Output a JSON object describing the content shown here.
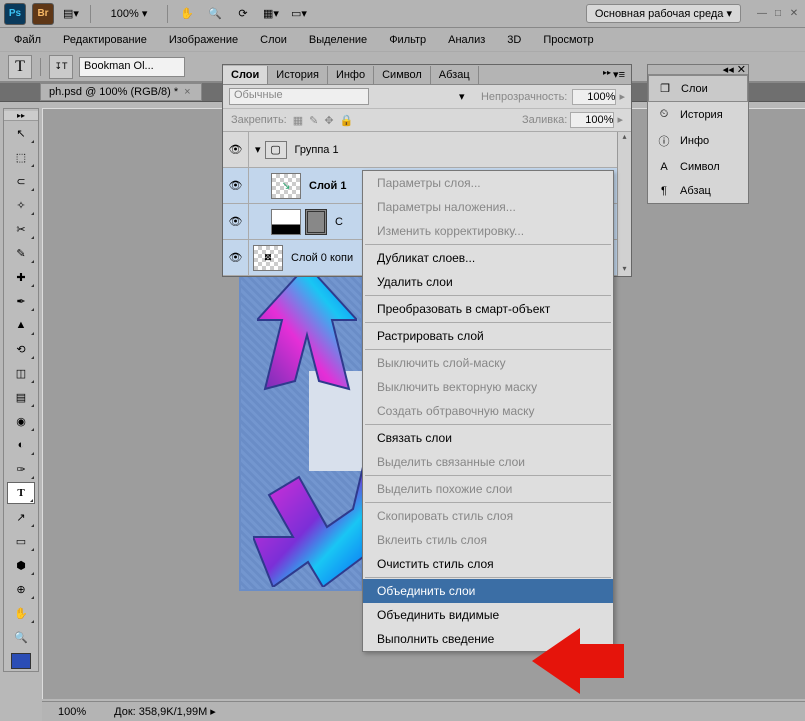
{
  "top": {
    "ps": "Ps",
    "br": "Br",
    "zoom": "100% ▾",
    "workspace": "Основная рабочая среда ▾"
  },
  "menu": [
    "Файл",
    "Редактирование",
    "Изображение",
    "Слои",
    "Выделение",
    "Фильтр",
    "Анализ",
    "3D",
    "Просмотр"
  ],
  "options": {
    "font": "Bookman Ol..."
  },
  "doc_tab": "ph.psd @ 100% (RGB/8) *",
  "layers_panel": {
    "tabs": [
      "Слои",
      "История",
      "Инфо",
      "Символ",
      "Абзац"
    ],
    "mode": "Обычные",
    "opacity_label": "Непрозрачность:",
    "opacity_val": "100%",
    "lock_label": "Закрепить:",
    "fill_label": "Заливка:",
    "fill_val": "100%",
    "rows": [
      {
        "name": "Группа 1"
      },
      {
        "name": "Слой 1"
      },
      {
        "name": "С"
      },
      {
        "name": "Слой 0 копи"
      }
    ]
  },
  "ctx": [
    {
      "t": "Параметры слоя...",
      "d": true
    },
    {
      "t": "Параметры наложения...",
      "d": true
    },
    {
      "t": "Изменить корректировку...",
      "d": true
    },
    {
      "sep": true
    },
    {
      "t": "Дубликат слоев..."
    },
    {
      "t": "Удалить слои"
    },
    {
      "sep": true
    },
    {
      "t": "Преобразовать в смарт-объект"
    },
    {
      "sep": true
    },
    {
      "t": "Растрировать слой"
    },
    {
      "sep": true
    },
    {
      "t": "Выключить слой-маску",
      "d": true
    },
    {
      "t": "Выключить векторную маску",
      "d": true
    },
    {
      "t": "Создать обтравочную маску",
      "d": true
    },
    {
      "sep": true
    },
    {
      "t": "Связать слои"
    },
    {
      "t": "Выделить связанные слои",
      "d": true
    },
    {
      "sep": true
    },
    {
      "t": "Выделить похожие слои",
      "d": true
    },
    {
      "sep": true
    },
    {
      "t": "Скопировать стиль слоя",
      "d": true
    },
    {
      "t": "Вклеить стиль слоя",
      "d": true
    },
    {
      "t": "Очистить стиль слоя"
    },
    {
      "sep": true
    },
    {
      "t": "Объединить слои",
      "hover": true
    },
    {
      "t": "Объединить видимые"
    },
    {
      "t": "Выполнить сведение"
    }
  ],
  "right_drop": [
    {
      "icon": "❐",
      "label": "Слои",
      "active": true
    },
    {
      "icon": "⏲",
      "label": "История"
    },
    {
      "icon": "ⓘ",
      "label": "Инфо"
    },
    {
      "icon": "A",
      "label": "Символ"
    },
    {
      "icon": "¶",
      "label": "Абзац"
    }
  ],
  "status": {
    "zoom": "100%",
    "doc": "Док: 358,9K/1,99M"
  }
}
